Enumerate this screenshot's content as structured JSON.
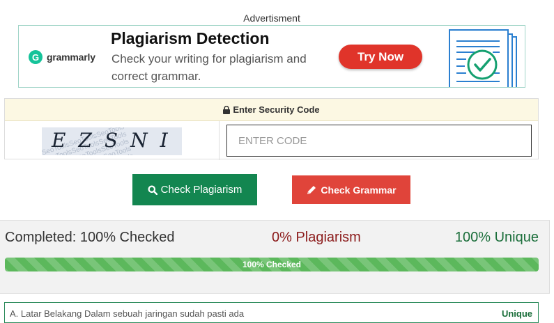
{
  "advertisement": {
    "label": "Advertisment",
    "brand": "grammarly",
    "brand_letter": "G",
    "title": "Plagiarism Detection",
    "subtitle": "Check your writing for plagiarism and correct grammar.",
    "cta": "Try Now"
  },
  "security": {
    "header": "Enter Security Code",
    "captcha_text": "EZSNI",
    "captcha_watermark": "SeoToolsSeoToolsSeoTools",
    "input_placeholder": "ENTER CODE"
  },
  "actions": {
    "check_plagiarism": "Check Plagiarism",
    "check_grammar": "Check Grammar"
  },
  "results": {
    "completed": "Completed: 100% Checked",
    "plagiarism": "0% Plagiarism",
    "unique": "100% Unique",
    "progress_label": "100% Checked",
    "progress_fraction": 1.0,
    "first_result_text": "A. Latar Belakang Dalam sebuah jaringan sudah pasti ada",
    "first_result_status": "Unique"
  },
  "colors": {
    "green_button": "#138650",
    "red_button": "#e0443a",
    "progress": "#5cb85c",
    "plagiarism_text": "#8b1a1a",
    "unique_text": "#1a6e3a"
  }
}
